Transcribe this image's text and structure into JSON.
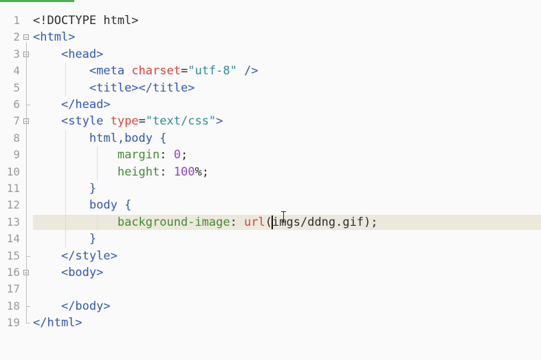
{
  "editor": {
    "lines": [
      {
        "num": "1",
        "fold": false,
        "tokens": [
          {
            "t": "<!DOCTYPE html>",
            "c": "plain"
          }
        ]
      },
      {
        "num": "2",
        "fold": true,
        "tokens": [
          {
            "t": "<html>",
            "c": "tag"
          }
        ]
      },
      {
        "num": "3",
        "fold": true,
        "tokens": [
          {
            "t": "    ",
            "c": "plain"
          },
          {
            "t": "<head>",
            "c": "tag"
          }
        ]
      },
      {
        "num": "4",
        "fold": false,
        "tokens": [
          {
            "t": "        ",
            "c": "plain"
          },
          {
            "t": "<meta ",
            "c": "tag"
          },
          {
            "t": "charset",
            "c": "attr"
          },
          {
            "t": "=",
            "c": "plain"
          },
          {
            "t": "\"utf-8\"",
            "c": "str"
          },
          {
            "t": " />",
            "c": "tag"
          }
        ]
      },
      {
        "num": "5",
        "fold": false,
        "tokens": [
          {
            "t": "        ",
            "c": "plain"
          },
          {
            "t": "<title></title>",
            "c": "tag"
          }
        ]
      },
      {
        "num": "6",
        "fold": false,
        "tokens": [
          {
            "t": "    ",
            "c": "plain"
          },
          {
            "t": "</head>",
            "c": "tag"
          }
        ]
      },
      {
        "num": "7",
        "fold": true,
        "tokens": [
          {
            "t": "    ",
            "c": "plain"
          },
          {
            "t": "<style ",
            "c": "tag"
          },
          {
            "t": "type",
            "c": "attr"
          },
          {
            "t": "=",
            "c": "plain"
          },
          {
            "t": "\"text/css\"",
            "c": "str"
          },
          {
            "t": ">",
            "c": "tag"
          }
        ]
      },
      {
        "num": "8",
        "fold": false,
        "tokens": [
          {
            "t": "        ",
            "c": "plain"
          },
          {
            "t": "html,body {",
            "c": "sel"
          }
        ]
      },
      {
        "num": "9",
        "fold": false,
        "tokens": [
          {
            "t": "            ",
            "c": "plain"
          },
          {
            "t": "margin",
            "c": "prop"
          },
          {
            "t": ": ",
            "c": "plain"
          },
          {
            "t": "0",
            "c": "num"
          },
          {
            "t": ";",
            "c": "plain"
          }
        ]
      },
      {
        "num": "10",
        "fold": false,
        "tokens": [
          {
            "t": "            ",
            "c": "plain"
          },
          {
            "t": "height",
            "c": "prop"
          },
          {
            "t": ": ",
            "c": "plain"
          },
          {
            "t": "100",
            "c": "num"
          },
          {
            "t": "%;",
            "c": "plain"
          }
        ]
      },
      {
        "num": "11",
        "fold": false,
        "tokens": [
          {
            "t": "        ",
            "c": "plain"
          },
          {
            "t": "}",
            "c": "sel"
          }
        ]
      },
      {
        "num": "12",
        "fold": false,
        "tokens": [
          {
            "t": "        ",
            "c": "plain"
          },
          {
            "t": "body {",
            "c": "sel"
          }
        ]
      },
      {
        "num": "13",
        "fold": false,
        "highlight": true,
        "tokens": [
          {
            "t": "            ",
            "c": "plain"
          },
          {
            "t": "background-image",
            "c": "prop"
          },
          {
            "t": ": ",
            "c": "plain"
          },
          {
            "t": "url",
            "c": "func"
          },
          {
            "t": "(imgs/ddng.gif);",
            "c": "plain"
          }
        ]
      },
      {
        "num": "14",
        "fold": false,
        "tokens": [
          {
            "t": "        ",
            "c": "plain"
          },
          {
            "t": "}",
            "c": "sel"
          }
        ]
      },
      {
        "num": "15",
        "fold": false,
        "tokens": [
          {
            "t": "    ",
            "c": "plain"
          },
          {
            "t": "</style>",
            "c": "tag"
          }
        ]
      },
      {
        "num": "16",
        "fold": true,
        "tokens": [
          {
            "t": "    ",
            "c": "plain"
          },
          {
            "t": "<body>",
            "c": "tag"
          }
        ]
      },
      {
        "num": "17",
        "fold": false,
        "tokens": []
      },
      {
        "num": "18",
        "fold": false,
        "tokens": [
          {
            "t": "    ",
            "c": "plain"
          },
          {
            "t": "</body>",
            "c": "tag"
          }
        ]
      },
      {
        "num": "19",
        "fold": false,
        "tokens": [
          {
            "t": "</html>",
            "c": "tag"
          }
        ]
      }
    ],
    "caret": {
      "line": "13",
      "column": 30
    },
    "colors": {
      "background": "#fafafa",
      "line_numbers": "#9a9a9a",
      "current_line": "#ece8dc",
      "tag": "#2f57b0",
      "attribute": "#d8443a",
      "string": "#2e8a9a",
      "property": "#3f8a2f",
      "number": "#8e44c4",
      "accent": "#4caf50"
    }
  }
}
